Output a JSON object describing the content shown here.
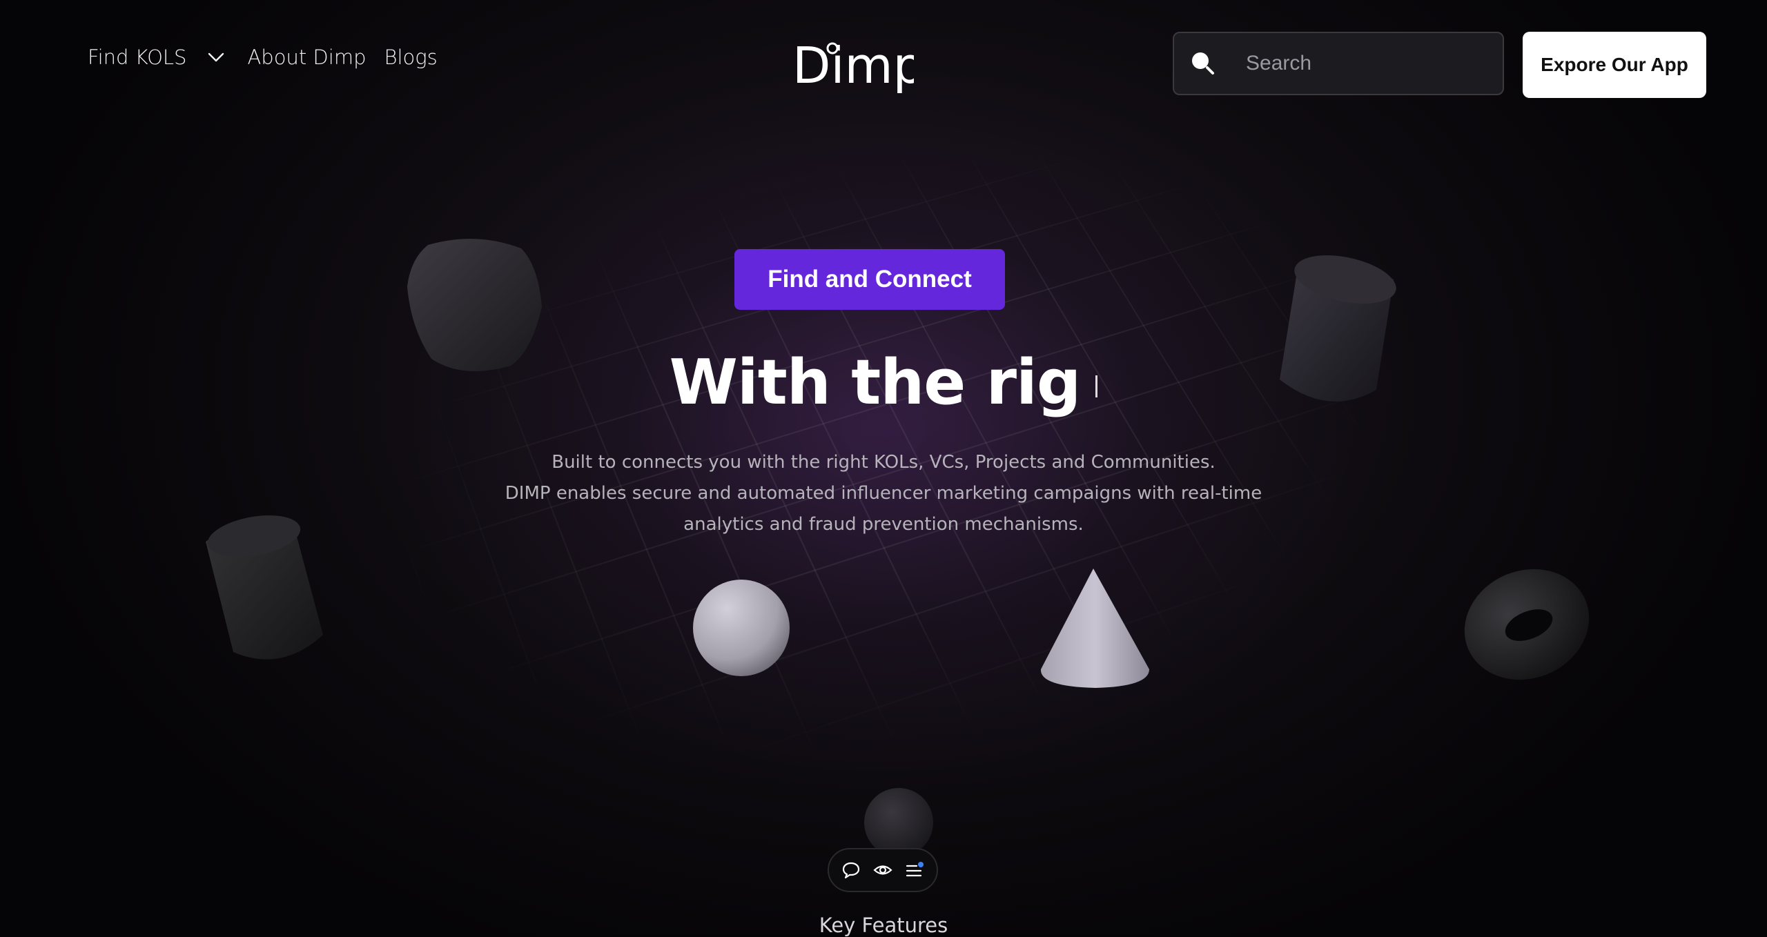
{
  "nav": {
    "find_kols": "Find KOLS",
    "about": "About Dimp",
    "blogs": "Blogs"
  },
  "brand": {
    "logo_text": "Dimp"
  },
  "search": {
    "placeholder": "Search"
  },
  "cta": {
    "explore_label": "Expore Our App"
  },
  "hero": {
    "badge_label": "Find and Connect",
    "headline": "With the rig",
    "subtext_lines": [
      "Built to connects you with the right KOLs, VCs, Projects and Communities.",
      "DIMP enables secure and automated influencer marketing campaigns with real-time",
      "analytics and fraud prevention mechanisms."
    ]
  },
  "floating_bar": {
    "icons": [
      "chat-bubble-icon",
      "eye-icon",
      "menu-list-icon"
    ]
  },
  "section": {
    "key_features": "Key Features"
  },
  "colors": {
    "accent_purple": "#6527dc",
    "background": "#050406",
    "notification_dot": "#3b82f6"
  }
}
